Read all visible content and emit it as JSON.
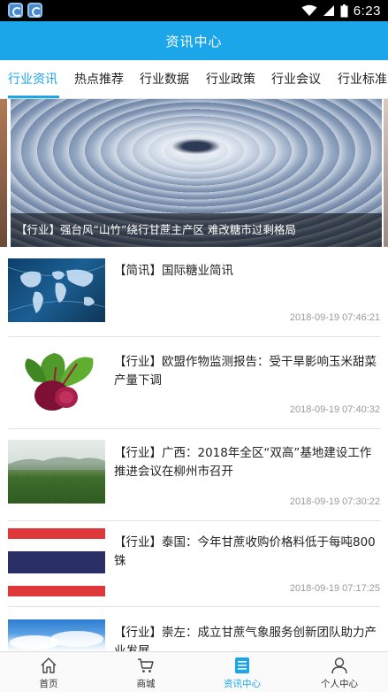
{
  "status_bar": {
    "time": "6:23"
  },
  "header": {
    "title": "资讯中心"
  },
  "tabs": [
    {
      "label": "行业资讯"
    },
    {
      "label": "热点推荐"
    },
    {
      "label": "行业数据"
    },
    {
      "label": "行业政策"
    },
    {
      "label": "行业会议"
    },
    {
      "label": "行业标准"
    }
  ],
  "banner": {
    "caption": "【行业】强台风“山竹”绕行甘蔗主产区 难改糖市过剩格局"
  },
  "news": [
    {
      "title": "【简讯】国际糖业简讯",
      "time": "2018-09-19 07:46:21"
    },
    {
      "title": "【行业】欧盟作物监测报告：受干旱影响玉米甜菜产量下调",
      "time": "2018-09-19 07:40:32"
    },
    {
      "title": "【行业】广西：2018年全区“双高”基地建设工作推进会议在柳州市召开",
      "time": "2018-09-19 07:30:22"
    },
    {
      "title": "【行业】泰国：今年甘蔗收购价格料低于每吨800铢",
      "time": "2018-09-19 07:17:25"
    },
    {
      "title": "【行业】崇左：成立甘蔗气象服务创新团队助力产业发展",
      "time": ""
    }
  ],
  "bottom_nav": [
    {
      "label": "首页",
      "icon": "home-icon"
    },
    {
      "label": "商城",
      "icon": "cart-icon"
    },
    {
      "label": "资讯中心",
      "icon": "news-icon"
    },
    {
      "label": "个人中心",
      "icon": "user-icon"
    }
  ],
  "colors": {
    "accent": "#1aa6e8",
    "statusbar": "#000000",
    "caption_overlay": "#000000"
  }
}
